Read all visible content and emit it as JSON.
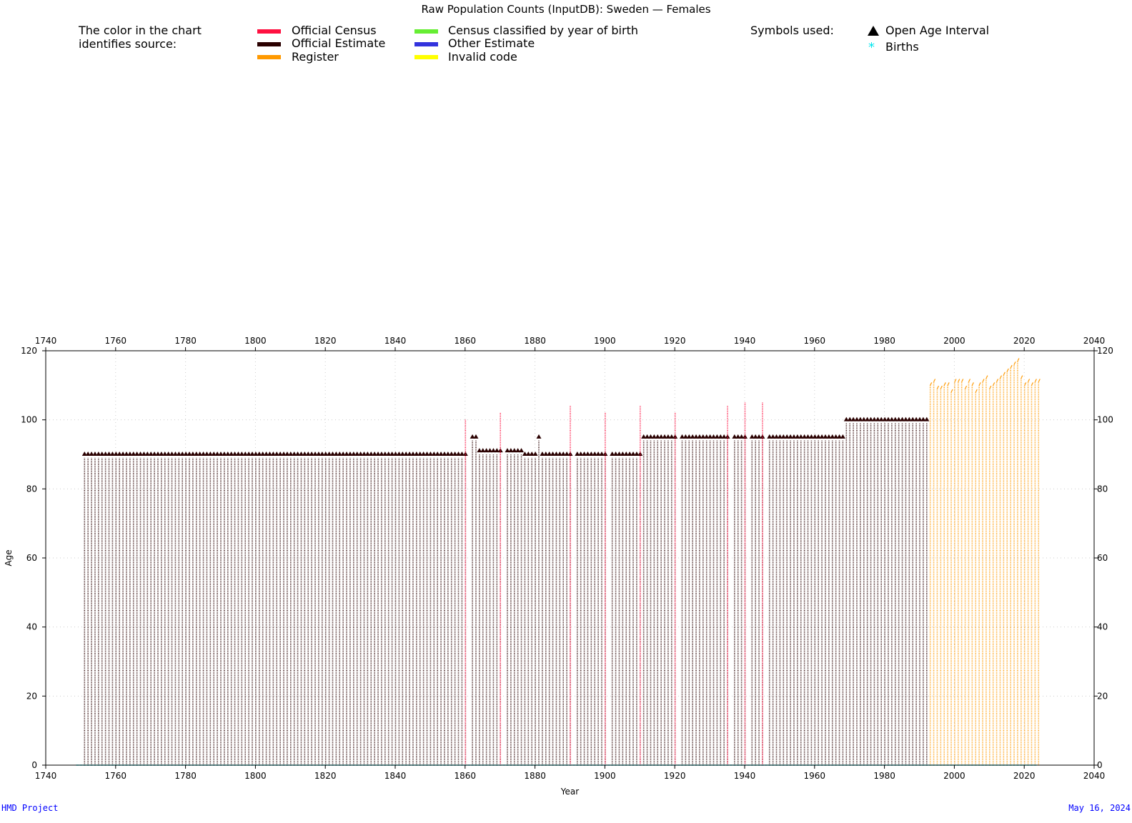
{
  "title": "Raw Population Counts (InputDB): Sweden — Females",
  "legend": {
    "intro_line1": "The color in the chart",
    "intro_line2": "identifies source:",
    "sources": [
      {
        "label": "Official Census",
        "color": "#ff1040"
      },
      {
        "label": "Official Estimate",
        "color": "#2a0000"
      },
      {
        "label": "Register",
        "color": "#ff9900"
      },
      {
        "label": "Census classified by year of birth",
        "color": "#66ee33"
      },
      {
        "label": "Other Estimate",
        "color": "#3333dd"
      },
      {
        "label": "Invalid code",
        "color": "#ffff00"
      }
    ],
    "symbols_title": "Symbols used:",
    "symbols": [
      {
        "label": "Open Age Interval",
        "icon": "triangle-icon",
        "color": "#000000"
      },
      {
        "label": "Births",
        "icon": "asterisk-icon",
        "color": "#00e5ee"
      }
    ]
  },
  "footer": {
    "left": "HMD Project",
    "right": "May 16, 2024"
  },
  "chart_data": {
    "type": "scatter",
    "xlabel": "Year",
    "ylabel": "Age",
    "xlim": [
      1740,
      2040
    ],
    "ylim": [
      0,
      120
    ],
    "x_ticks": [
      1740,
      1760,
      1780,
      1800,
      1820,
      1840,
      1860,
      1880,
      1900,
      1920,
      1940,
      1960,
      1980,
      2000,
      2020,
      2040
    ],
    "y_ticks": [
      0,
      20,
      40,
      60,
      80,
      100,
      120
    ],
    "grid": true,
    "open_age_segments": [
      {
        "from": 1751,
        "to": 1860,
        "open_age": 90,
        "source": "Official Estimate"
      },
      {
        "from": 1862,
        "to": 1863,
        "open_age": 95,
        "source": "Official Estimate"
      },
      {
        "from": 1864,
        "to": 1870,
        "open_age": 91,
        "source": "Official Estimate"
      },
      {
        "from": 1872,
        "to": 1876,
        "open_age": 91,
        "source": "Official Estimate"
      },
      {
        "from": 1877,
        "to": 1880,
        "open_age": 90,
        "source": "Official Estimate"
      },
      {
        "from": 1881,
        "to": 1881,
        "open_age": 95,
        "source": "Official Estimate"
      },
      {
        "from": 1882,
        "to": 1890,
        "open_age": 90,
        "source": "Official Estimate"
      },
      {
        "from": 1892,
        "to": 1900,
        "open_age": 90,
        "source": "Official Estimate"
      },
      {
        "from": 1902,
        "to": 1910,
        "open_age": 90,
        "source": "Official Estimate"
      },
      {
        "from": 1911,
        "to": 1920,
        "open_age": 95,
        "source": "Official Estimate"
      },
      {
        "from": 1922,
        "to": 1935,
        "open_age": 95,
        "source": "Official Estimate"
      },
      {
        "from": 1937,
        "to": 1940,
        "open_age": 95,
        "source": "Official Estimate"
      },
      {
        "from": 1942,
        "to": 1945,
        "open_age": 95,
        "source": "Official Estimate"
      },
      {
        "from": 1947,
        "to": 1968,
        "open_age": 95,
        "source": "Official Estimate"
      },
      {
        "from": 1969,
        "to": 1992,
        "open_age": 100,
        "source": "Official Estimate"
      }
    ],
    "census_years": [
      {
        "year": 1860,
        "max_age": 100
      },
      {
        "year": 1870,
        "max_age": 102
      },
      {
        "year": 1890,
        "max_age": 104
      },
      {
        "year": 1900,
        "max_age": 102
      },
      {
        "year": 1910,
        "max_age": 104
      },
      {
        "year": 1920,
        "max_age": 102
      },
      {
        "year": 1935,
        "max_age": 104
      },
      {
        "year": 1940,
        "max_age": 105
      },
      {
        "year": 1945,
        "max_age": 105
      }
    ],
    "register_years": [
      {
        "year": 1993,
        "max_age": 110
      },
      {
        "year": 1994,
        "max_age": 111
      },
      {
        "year": 1995,
        "max_age": 109
      },
      {
        "year": 1996,
        "max_age": 109
      },
      {
        "year": 1997,
        "max_age": 110
      },
      {
        "year": 1998,
        "max_age": 110
      },
      {
        "year": 1999,
        "max_age": 108
      },
      {
        "year": 2000,
        "max_age": 111
      },
      {
        "year": 2001,
        "max_age": 111
      },
      {
        "year": 2002,
        "max_age": 111
      },
      {
        "year": 2003,
        "max_age": 109
      },
      {
        "year": 2004,
        "max_age": 111
      },
      {
        "year": 2005,
        "max_age": 110
      },
      {
        "year": 2006,
        "max_age": 108
      },
      {
        "year": 2007,
        "max_age": 110
      },
      {
        "year": 2008,
        "max_age": 111
      },
      {
        "year": 2009,
        "max_age": 112
      },
      {
        "year": 2010,
        "max_age": 109
      },
      {
        "year": 2011,
        "max_age": 110
      },
      {
        "year": 2012,
        "max_age": 111
      },
      {
        "year": 2013,
        "max_age": 112
      },
      {
        "year": 2014,
        "max_age": 113
      },
      {
        "year": 2015,
        "max_age": 114
      },
      {
        "year": 2016,
        "max_age": 115
      },
      {
        "year": 2017,
        "max_age": 116
      },
      {
        "year": 2018,
        "max_age": 117
      },
      {
        "year": 2019,
        "max_age": 112
      },
      {
        "year": 2020,
        "max_age": 110
      },
      {
        "year": 2021,
        "max_age": 111
      },
      {
        "year": 2022,
        "max_age": 110
      },
      {
        "year": 2023,
        "max_age": 111
      },
      {
        "year": 2024,
        "max_age": 111
      }
    ],
    "births": {
      "from": 1749,
      "to": 2023,
      "age": 0
    }
  }
}
